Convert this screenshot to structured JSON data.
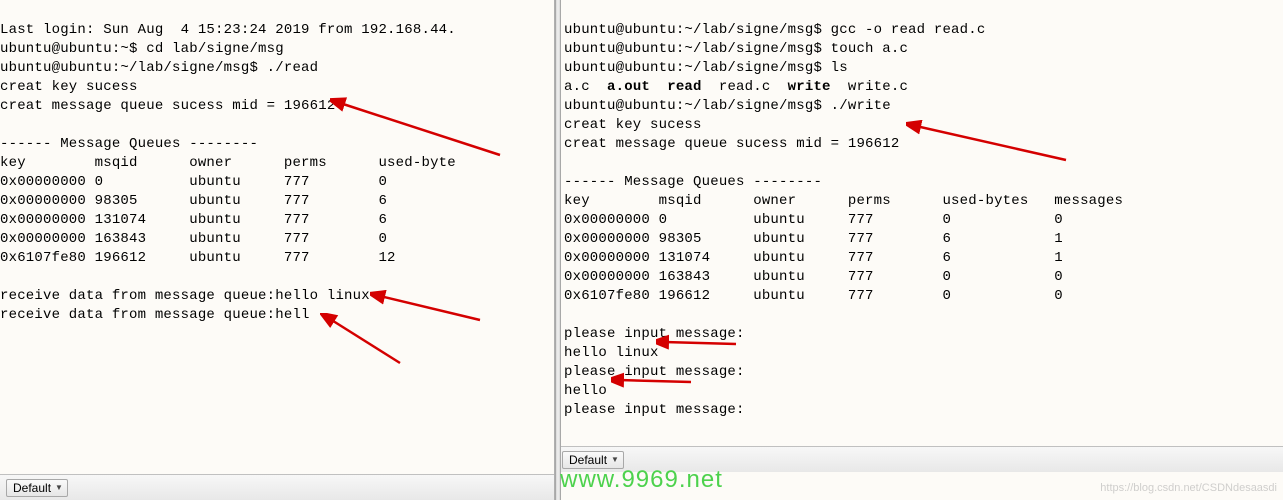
{
  "left": {
    "lines": {
      "l1": "Last login: Sun Aug  4 15:23:24 2019 from 192.168.44.",
      "l2": "ubuntu@ubuntu:~$ cd lab/signe/msg",
      "l3": "ubuntu@ubuntu:~/lab/signe/msg$ ./read",
      "l4": "creat key sucess",
      "l5": "creat message queue sucess mid = 196612",
      "l6": "",
      "l7": "------ Message Queues --------",
      "l8": "key        msqid      owner      perms      used-byte",
      "l9": "0x00000000 0          ubuntu     777        0",
      "l10": "0x00000000 98305      ubuntu     777        6",
      "l11": "0x00000000 131074     ubuntu     777        6",
      "l12": "0x00000000 163843     ubuntu     777        0",
      "l13": "0x6107fe80 196612     ubuntu     777        12",
      "l14": "",
      "l15": "receive data from message queue:hello linux",
      "l16": "receive data from message queue:hell"
    },
    "statusbar_label": "Default"
  },
  "right": {
    "lines": {
      "r1": "ubuntu@ubuntu:~/lab/signe/msg$ gcc -o read read.c",
      "r2": "ubuntu@ubuntu:~/lab/signe/msg$ touch a.c",
      "r3": "ubuntu@ubuntu:~/lab/signe/msg$ ls",
      "r4a": "a.c  ",
      "r4b": "a.out",
      "r4c": "  ",
      "r4d": "read",
      "r4e": "  read.c  ",
      "r4f": "write",
      "r4g": "  write.c",
      "r5": "ubuntu@ubuntu:~/lab/signe/msg$ ./write",
      "r6": "creat key sucess",
      "r7": "creat message queue sucess mid = 196612",
      "r8": "",
      "r9": "------ Message Queues --------",
      "r10": "key        msqid      owner      perms      used-bytes   messages",
      "r11": "0x00000000 0          ubuntu     777        0            0",
      "r12": "0x00000000 98305      ubuntu     777        6            1",
      "r13": "0x00000000 131074     ubuntu     777        6            1",
      "r14": "0x00000000 163843     ubuntu     777        0            0",
      "r15": "0x6107fe80 196612     ubuntu     777        0            0",
      "r16": "",
      "r17": "please input message:",
      "r18": "hello linux",
      "r19": "please input message:",
      "r20": "hello",
      "r21": "please input message:"
    },
    "statusbar_label": "Default"
  },
  "watermark_url": "www.9969.net",
  "watermark_csdn": "https://blog.csdn.net/CSDNdesaasdi"
}
